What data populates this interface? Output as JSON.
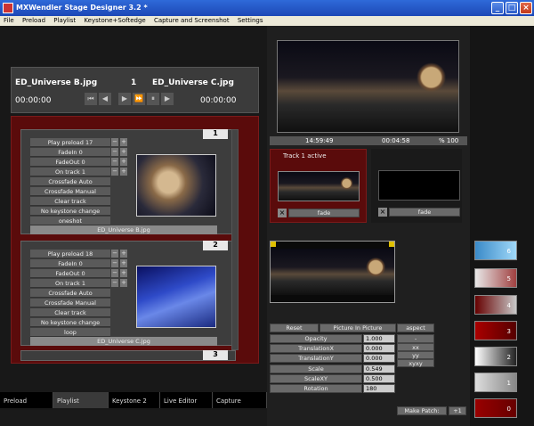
{
  "window": {
    "title": "MXWendler Stage Designer  3.2 *"
  },
  "menu": [
    "File",
    "Preload",
    "Playlist",
    "Keystone+Softedge",
    "Capture and Screenshot",
    "Settings"
  ],
  "transport": {
    "file_a": "ED_Universe B.jpg",
    "track_num": "1",
    "file_b": "ED_Universe C.jpg",
    "time_a": "00:00:00",
    "time_b": "00:00:00"
  },
  "playlist": {
    "slots": [
      {
        "number": "1",
        "preload": "Play preload 17",
        "fadein": "FadeIn  0",
        "fadeout": "FadeOut  0",
        "ontrack": "On track 1",
        "xfade_auto": "Crossfade Auto",
        "xfade_manual": "Crossfade Manual",
        "clear": "Clear track",
        "keystone": "No keystone change",
        "mode": "oneshot",
        "file": "ED_Universe B.jpg"
      },
      {
        "number": "2",
        "preload": "Play preload 18",
        "fadein": "FadeIn  0",
        "fadeout": "FadeOut  0",
        "ontrack": "On track 1",
        "xfade_auto": "Crossfade Auto",
        "xfade_manual": "Crossfade Manual",
        "clear": "Clear track",
        "keystone": "No keystone change",
        "mode": "loop",
        "file": "ED_Universe C.jpg"
      }
    ],
    "next_number": "3"
  },
  "tabs": [
    "Preload",
    "Playlist",
    "Keystone 2",
    "Live Editor",
    "Capture"
  ],
  "main_preview": {
    "time_a": "14:59:49",
    "time_b": "00:04:58",
    "zoom": "% 100"
  },
  "tracks": {
    "label": "Track 1 active",
    "fade_a": "fade",
    "fade_b": "fade"
  },
  "editor": {
    "reset": "Reset",
    "pip": "Picture In Picture",
    "aspect": "aspect",
    "dash": "-",
    "params": [
      {
        "label": "Opacity",
        "value": "1.000"
      },
      {
        "label": "TranslationX",
        "value": "0.000"
      },
      {
        "label": "TranslationY",
        "value": "0.000"
      },
      {
        "label": "Scale",
        "value": "0.549"
      },
      {
        "label": "ScaleXY",
        "value": "0.500"
      },
      {
        "label": "Rotation",
        "value": "180"
      }
    ],
    "xx": "xx",
    "yy": "yy",
    "xyxy": "xyxy",
    "make_patch": "Make Patch:",
    "patch_num": "+1"
  },
  "thumbs": [
    "6",
    "5",
    "4",
    "3",
    "2",
    "1",
    "0"
  ]
}
